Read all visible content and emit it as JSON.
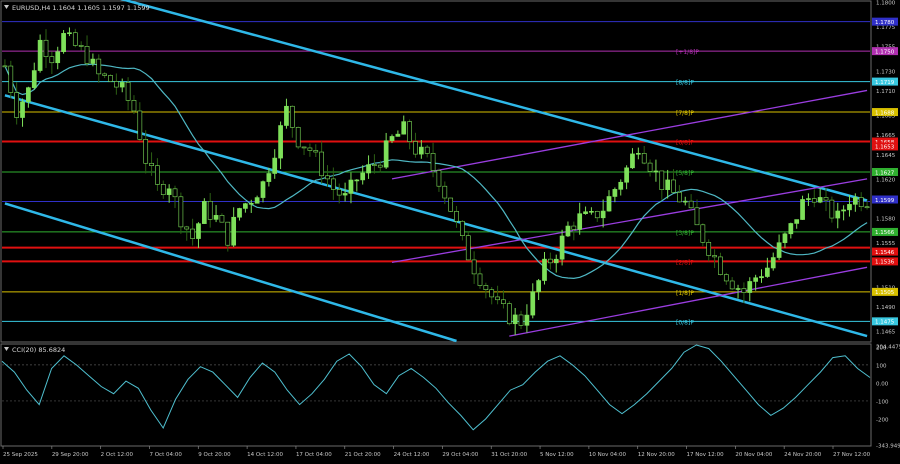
{
  "window": {
    "symbol_line": "EURUSD,H4  1.1604 1.1605 1.1597 1.1599",
    "osc_line": "CCI(20) 85.6824"
  },
  "colors": {
    "background": "#000000",
    "candle_bull": "#7ee05a",
    "candle_bear": "#2c5f14",
    "ma": "#4fb8c4",
    "channel_main": "#2fb8e8",
    "channel_purple": "#9a3de0",
    "level_red": "#e01010",
    "level_blue": "#3030c8",
    "level_yellow": "#d8c000",
    "level_cyan": "#38c8e0",
    "level_magenta": "#b030b0",
    "level_green": "#30b030",
    "cci_line": "#4fc0d0",
    "axis_text": "#c8c8c8"
  },
  "chart_data": {
    "type": "candlestick",
    "price_axis": {
      "ylim": [
        1.1455,
        1.18
      ],
      "ticks": [
        "1.1800",
        "1.1775",
        "1.1755",
        "1.1730",
        "1.1710",
        "1.1685",
        "1.1665",
        "1.1645",
        "1.1620",
        "1.1600",
        "1.1580",
        "1.1555",
        "1.1535",
        "1.1510",
        "1.1490",
        "1.1465"
      ]
    },
    "x_ticks": [
      "25 Sep 2025",
      "29 Sep 20:00",
      "2 Oct 12:00",
      "7 Oct 04:00",
      "9 Oct 20:00",
      "14 Oct 12:00",
      "17 Oct 04:00",
      "21 Oct 20:00",
      "24 Oct 12:00",
      "29 Oct 04:00",
      "31 Oct 20:00",
      "5 Nov 12:00",
      "10 Nov 04:00",
      "12 Nov 20:00",
      "17 Nov 12:00",
      "20 Nov 04:00",
      "24 Nov 20:00",
      "27 Nov 12:00"
    ],
    "close_path": [
      [
        0,
        1.1735
      ],
      [
        2,
        1.169
      ],
      [
        4,
        1.171
      ],
      [
        6,
        1.176
      ],
      [
        8,
        1.1745
      ],
      [
        10,
        1.1765
      ],
      [
        12,
        1.1755
      ],
      [
        14,
        1.1745
      ],
      [
        16,
        1.1725
      ],
      [
        18,
        1.172
      ],
      [
        20,
        1.171
      ],
      [
        22,
        1.169
      ],
      [
        24,
        1.164
      ],
      [
        26,
        1.161
      ],
      [
        28,
        1.1615
      ],
      [
        30,
        1.158
      ],
      [
        32,
        1.156
      ],
      [
        34,
        1.159
      ],
      [
        36,
        1.158
      ],
      [
        38,
        1.156
      ],
      [
        40,
        1.159
      ],
      [
        42,
        1.16
      ],
      [
        44,
        1.1615
      ],
      [
        46,
        1.165
      ],
      [
        48,
        1.169
      ],
      [
        50,
        1.166
      ],
      [
        52,
        1.165
      ],
      [
        54,
        1.163
      ],
      [
        56,
        1.161
      ],
      [
        58,
        1.16
      ],
      [
        60,
        1.162
      ],
      [
        62,
        1.163
      ],
      [
        64,
        1.164
      ],
      [
        66,
        1.166
      ],
      [
        68,
        1.167
      ],
      [
        70,
        1.165
      ],
      [
        72,
        1.164
      ],
      [
        74,
        1.162
      ],
      [
        76,
        1.159
      ],
      [
        78,
        1.1555
      ],
      [
        80,
        1.153
      ],
      [
        82,
        1.151
      ],
      [
        84,
        1.149
      ],
      [
        86,
        1.148
      ],
      [
        88,
        1.1475
      ],
      [
        90,
        1.15
      ],
      [
        92,
        1.153
      ],
      [
        94,
        1.1545
      ],
      [
        96,
        1.157
      ],
      [
        98,
        1.158
      ],
      [
        100,
        1.158
      ],
      [
        102,
        1.159
      ],
      [
        104,
        1.161
      ],
      [
        106,
        1.163
      ],
      [
        108,
        1.1655
      ],
      [
        110,
        1.1635
      ],
      [
        112,
        1.1615
      ],
      [
        114,
        1.1605
      ],
      [
        116,
        1.1595
      ],
      [
        118,
        1.157
      ],
      [
        120,
        1.155
      ],
      [
        122,
        1.153
      ],
      [
        124,
        1.1515
      ],
      [
        126,
        1.1505
      ],
      [
        128,
        1.152
      ],
      [
        130,
        1.153
      ],
      [
        132,
        1.155
      ],
      [
        134,
        1.157
      ],
      [
        136,
        1.1595
      ],
      [
        138,
        1.1605
      ],
      [
        140,
        1.159
      ],
      [
        142,
        1.158
      ],
      [
        144,
        1.16
      ],
      [
        146,
        1.1599
      ]
    ],
    "levels": [
      {
        "label": "[8/8]P",
        "value": 1.1719,
        "color": "#38c8e0"
      },
      {
        "label": "[7/8]P",
        "value": 1.1688,
        "color": "#d8c000"
      },
      {
        "label": "[6/8]P",
        "value": 1.1658,
        "color": "#e01010"
      },
      {
        "label": "[5/8]P",
        "value": 1.1627,
        "color": "#30b030"
      },
      {
        "label": "",
        "value": 1.1597,
        "color": "#3030c8"
      },
      {
        "label": "[3/8]P",
        "value": 1.1566,
        "color": "#30b030"
      },
      {
        "label": "",
        "value": 1.155,
        "color": "#e01010"
      },
      {
        "label": "[2/8]P",
        "value": 1.1536,
        "color": "#e01010"
      },
      {
        "label": "[1/8]P",
        "value": 1.1505,
        "color": "#d8c000"
      },
      {
        "label": "[0/8]P",
        "value": 1.1475,
        "color": "#38c8e0"
      },
      {
        "label": "[+1/8]P",
        "value": 1.175,
        "color": "#b030b0"
      },
      {
        "label": "",
        "value": 1.178,
        "color": "#3030c8"
      }
    ],
    "price_tags": [
      {
        "text": "1.1780",
        "value": 1.178,
        "bg": "#3030c8"
      },
      {
        "text": "1.1750",
        "value": 1.175,
        "bg": "#b030b0"
      },
      {
        "text": "1.1719",
        "value": 1.1719,
        "bg": "#38c8e0"
      },
      {
        "text": "1.1688",
        "value": 1.1688,
        "bg": "#d8c000"
      },
      {
        "text": "1.1658",
        "value": 1.1658,
        "bg": "#e01010"
      },
      {
        "text": "1.1653",
        "value": 1.1653,
        "bg": "#e01010"
      },
      {
        "text": "1.1627",
        "value": 1.1627,
        "bg": "#30b030"
      },
      {
        "text": "1.1599",
        "value": 1.1599,
        "bg": "#3030c8"
      },
      {
        "text": "1.1566",
        "value": 1.1566,
        "bg": "#30b030"
      },
      {
        "text": "1.1546",
        "value": 1.1546,
        "bg": "#e01010"
      },
      {
        "text": "1.1536",
        "value": 1.1536,
        "bg": "#e01010"
      },
      {
        "text": "1.1505",
        "value": 1.1505,
        "bg": "#d8c000"
      },
      {
        "text": "1.1475",
        "value": 1.1475,
        "bg": "#38c8e0"
      }
    ],
    "trend_lines": [
      {
        "color": "#2fb8e8",
        "from": [
          0,
          1.1835
        ],
        "to": [
          147,
          1.1598
        ]
      },
      {
        "color": "#2fb8e8",
        "from": [
          0,
          1.1705
        ],
        "to": [
          147,
          1.146
        ]
      },
      {
        "color": "#2fb8e8",
        "from": [
          0,
          1.1595
        ],
        "to": [
          77,
          1.1455
        ]
      },
      {
        "color": "#9a3de0",
        "from": [
          66,
          1.162
        ],
        "to": [
          147,
          1.171
        ]
      },
      {
        "color": "#9a3de0",
        "from": [
          66,
          1.1535
        ],
        "to": [
          147,
          1.162
        ]
      },
      {
        "color": "#9a3de0",
        "from": [
          86,
          1.146
        ],
        "to": [
          147,
          1.153
        ]
      }
    ],
    "osc": {
      "ylim": [
        -343.9494,
        204.4475
      ],
      "ticks": [
        "204.4475",
        "200",
        "100",
        "0.00",
        "-100",
        "-200",
        "-343.9494"
      ],
      "values": [
        120,
        60,
        -40,
        -120,
        80,
        150,
        100,
        40,
        -20,
        -60,
        10,
        -30,
        -150,
        -250,
        -90,
        20,
        90,
        60,
        -10,
        -80,
        30,
        110,
        60,
        -40,
        -120,
        -60,
        20,
        120,
        160,
        90,
        -10,
        -60,
        40,
        80,
        30,
        -30,
        -110,
        -180,
        -260,
        -200,
        -120,
        -40,
        -10,
        60,
        120,
        150,
        100,
        40,
        -40,
        -120,
        -170,
        -120,
        -60,
        10,
        80,
        170,
        210,
        190,
        120,
        40,
        -40,
        -120,
        -180,
        -140,
        -80,
        -10,
        60,
        140,
        150,
        80,
        30
      ]
    }
  }
}
